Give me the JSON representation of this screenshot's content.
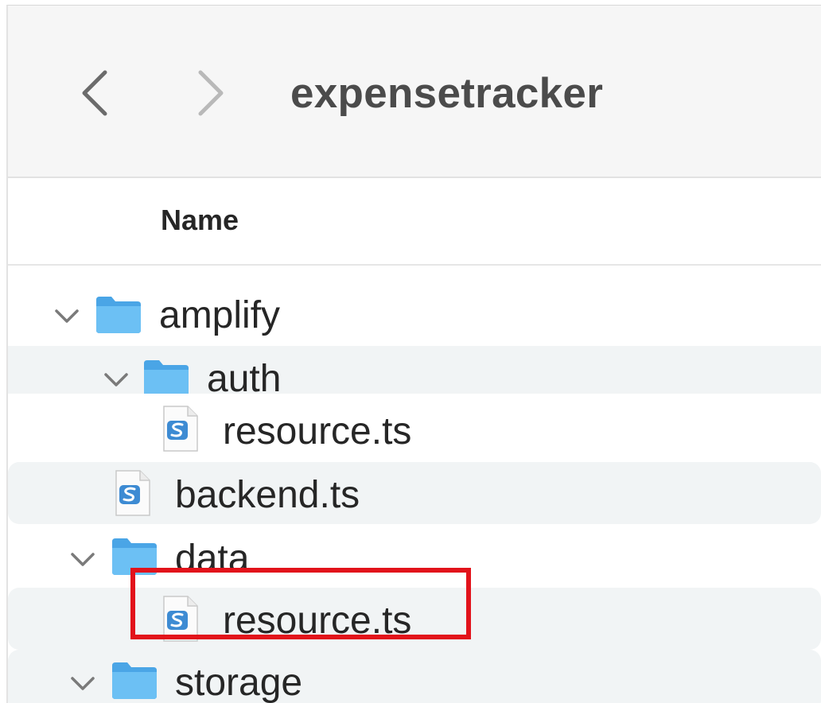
{
  "window": {
    "title": "expensetracker"
  },
  "column_header": {
    "name": "Name"
  },
  "rows": [
    {
      "label": "amplify",
      "kind": "folder",
      "expanded": true
    },
    {
      "label": "auth",
      "kind": "folder",
      "expanded": true
    },
    {
      "label": "resource.ts",
      "kind": "file"
    },
    {
      "label": "backend.ts",
      "kind": "file"
    },
    {
      "label": "data",
      "kind": "folder",
      "expanded": true
    },
    {
      "label": "resource.ts",
      "kind": "file",
      "highlighted": true
    },
    {
      "label": "storage",
      "kind": "folder",
      "expanded": true
    }
  ],
  "icons": {
    "back": "chevron-left-icon",
    "forward": "chevron-right-icon",
    "disclosure": "chevron-down-icon",
    "folder": "folder-icon",
    "file": "typescript-file-icon"
  },
  "colors": {
    "folder": "#5fb4ee",
    "file_badge": "#3d8bd3",
    "highlight": "#e2131b",
    "selected_row": "#f1f4f5"
  }
}
